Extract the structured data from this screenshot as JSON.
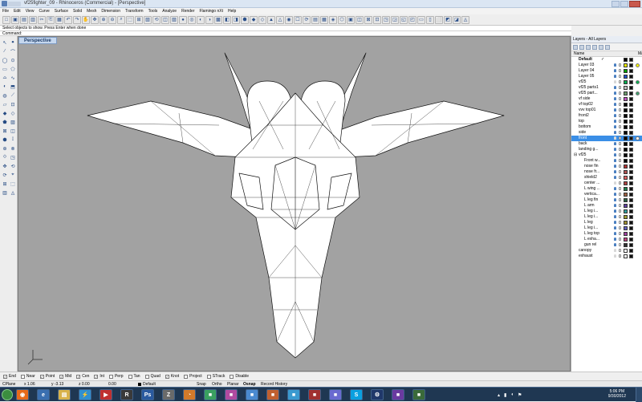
{
  "titlebar": {
    "title": "vf25fighter_09 - Rhinoceros (Commercial) - [Perspective]"
  },
  "menus": [
    "File",
    "Edit",
    "View",
    "Curve",
    "Surface",
    "Solid",
    "Mesh",
    "Dimension",
    "Transform",
    "Tools",
    "Analyze",
    "Render",
    "Flamingo nXt",
    "Help"
  ],
  "command": {
    "history": "Select objects to show. Press Enter when done",
    "prompt": "Command:"
  },
  "viewport": {
    "label": "Perspective",
    "background": "#a2a2a2"
  },
  "layers": {
    "title": "Layers - All Layers",
    "column_name": "Name",
    "column_material": "Ma",
    "rows": [
      {
        "name": "Default",
        "indent": 0,
        "current": true,
        "check": "✓",
        "color": "#000000",
        "lit": true
      },
      {
        "name": "Layer 03",
        "indent": 0,
        "color": "#f5f500",
        "lit": true,
        "circle": "#f5f500"
      },
      {
        "name": "Layer 04",
        "indent": 0,
        "color": "#00a000",
        "lit": true
      },
      {
        "name": "Layer 05",
        "indent": 0,
        "color": "#1e50c8",
        "lit": true
      },
      {
        "name": "vf25",
        "indent": 0,
        "color": "#00b050",
        "lit": false,
        "circle": "#00b050"
      },
      {
        "name": "vf25 parts1",
        "indent": 0,
        "color": "#c0c0c0",
        "lit": true
      },
      {
        "name": "vf25 part...",
        "indent": 0,
        "color": "#6c9d6c",
        "lit": true,
        "circle": "#3c9f6c"
      },
      {
        "name": "vf side",
        "indent": 0,
        "color": "#c050c0",
        "lit": true
      },
      {
        "name": "vf top02",
        "indent": 0,
        "color": "#000000",
        "lit": true
      },
      {
        "name": "vvv top01",
        "indent": 0,
        "color": "#000000",
        "lit": true
      },
      {
        "name": "front2",
        "indent": 0,
        "color": "#000000",
        "lit": true
      },
      {
        "name": "top",
        "indent": 0,
        "color": "#000000",
        "lit": true
      },
      {
        "name": "bottom",
        "indent": 0,
        "color": "#000000",
        "lit": true
      },
      {
        "name": "side",
        "indent": 0,
        "color": "#000000",
        "lit": true
      },
      {
        "name": "front",
        "indent": 0,
        "color": "#000000",
        "lit": false,
        "selected": true,
        "circle": "#ffffff"
      },
      {
        "name": "back",
        "indent": 0,
        "color": "#000000",
        "lit": true
      },
      {
        "name": "landing g...",
        "indent": 0,
        "color": "#000000",
        "lit": true
      },
      {
        "name": "vf25",
        "indent": 0,
        "expander": "⊟",
        "color": "#000000",
        "lit": true
      },
      {
        "name": "Front w...",
        "indent": 1,
        "color": "#000000",
        "lit": true
      },
      {
        "name": "nose fin",
        "indent": 1,
        "color": "#b03030",
        "lit": true
      },
      {
        "name": "nose fr...",
        "indent": 1,
        "color": "#b05050",
        "lit": true
      },
      {
        "name": "shield2",
        "indent": 1,
        "color": "#e06060",
        "lit": true
      },
      {
        "name": "center ...",
        "indent": 1,
        "color": "#b04040",
        "lit": false
      },
      {
        "name": "L wing ...",
        "indent": 1,
        "color": "#1b7f4b",
        "lit": true
      },
      {
        "name": "vertica...",
        "indent": 1,
        "color": "#a06040",
        "lit": true
      },
      {
        "name": "L leg fin",
        "indent": 1,
        "color": "#2a6040",
        "lit": true
      },
      {
        "name": "L arm",
        "indent": 1,
        "color": "#6040a0",
        "lit": true
      },
      {
        "name": "L leg i...",
        "indent": 1,
        "color": "#30a0a0",
        "lit": true
      },
      {
        "name": "L leg i...",
        "indent": 1,
        "color": "#a0a030",
        "lit": true
      },
      {
        "name": "L leg",
        "indent": 1,
        "color": "#a09030",
        "lit": true
      },
      {
        "name": "L leg i...",
        "indent": 1,
        "color": "#6060c0",
        "lit": true
      },
      {
        "name": "L leg top",
        "indent": 1,
        "color": "#a040a0",
        "lit": true
      },
      {
        "name": "L exha...",
        "indent": 1,
        "color": "#c04080",
        "lit": true
      },
      {
        "name": "gun rel",
        "indent": 1,
        "color": "#303030",
        "lit": true
      },
      {
        "name": "canopy",
        "indent": 0,
        "color": "#ffffff",
        "lit": false
      },
      {
        "name": "exhaust",
        "indent": 0,
        "color": "#ffffff",
        "lit": false
      }
    ]
  },
  "osnaps": [
    {
      "label": "End",
      "checked": true
    },
    {
      "label": "Near",
      "checked": false
    },
    {
      "label": "Point",
      "checked": true
    },
    {
      "label": "Mid",
      "checked": true
    },
    {
      "label": "Cen",
      "checked": true
    },
    {
      "label": "Int",
      "checked": true
    },
    {
      "label": "Perp",
      "checked": false
    },
    {
      "label": "Tan",
      "checked": false
    },
    {
      "label": "Quad",
      "checked": false
    },
    {
      "label": "Knot",
      "checked": true
    },
    {
      "label": "Project",
      "checked": false
    },
    {
      "label": "STrack",
      "checked": false
    },
    {
      "label": "Disable",
      "checked": false
    }
  ],
  "status": {
    "cplane": "CPlane",
    "x": "x 1.06",
    "y": "y -3.13",
    "z": "z 0.00",
    "units": "0.00",
    "layer": "Default",
    "snap": "Snap",
    "ortho": "Ortho",
    "planar": "Planar",
    "osnap": "Osnap",
    "record": "Record History"
  },
  "taskbar": {
    "time": "5:06 PM",
    "date": "9/30/2012",
    "apps": [
      "firefox",
      "explorer",
      "folder",
      "winamp",
      "media",
      "rhino",
      "photoshop",
      "zbrush",
      "blender",
      "app",
      "app",
      "app",
      "app",
      "app",
      "app",
      "app",
      "skype",
      "steam",
      "app",
      "app"
    ]
  }
}
